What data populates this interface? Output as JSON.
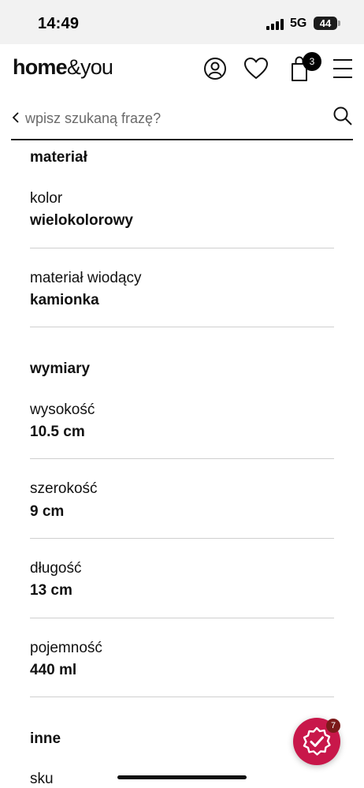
{
  "status_bar": {
    "time": "14:49",
    "network": "5G",
    "battery": "44"
  },
  "header": {
    "logo_home": "home",
    "logo_you": "&you",
    "cart_count": "3",
    "icons": [
      "user-icon",
      "heart-icon",
      "shopping-bag-icon",
      "menu-icon"
    ]
  },
  "search": {
    "placeholder": "wpisz szukaną frazę?",
    "value": ""
  },
  "sections": {
    "material": {
      "title": "materiał",
      "items": [
        {
          "label": "kolor",
          "value": "wielokolorowy"
        },
        {
          "label": "materiał wiodący",
          "value": "kamionka"
        }
      ]
    },
    "dimensions": {
      "title": "wymiary",
      "items": [
        {
          "label": "wysokość",
          "value": "10.5 cm"
        },
        {
          "label": "szerokość",
          "value": "9 cm"
        },
        {
          "label": "długość",
          "value": "13 cm"
        },
        {
          "label": "pojemność",
          "value": "440 ml"
        }
      ]
    },
    "other": {
      "title": "inne",
      "items": [
        {
          "label": "sku"
        }
      ]
    }
  },
  "trust_badge": {
    "count": "7",
    "color": "#c8174a"
  }
}
